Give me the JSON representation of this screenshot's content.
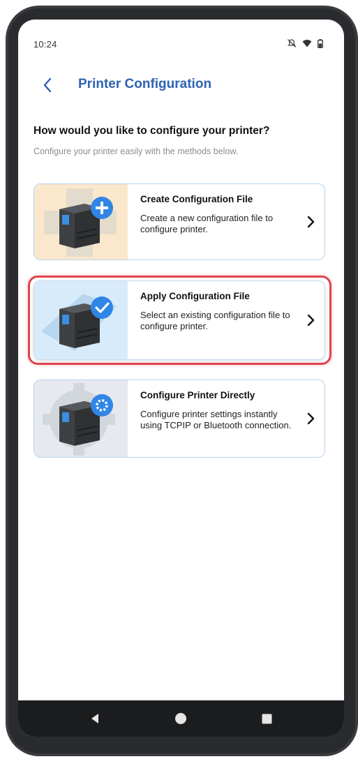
{
  "status_bar": {
    "time": "10:24",
    "icons": [
      "notifications-off-icon",
      "wifi-icon",
      "battery-icon"
    ]
  },
  "app_bar": {
    "back_icon": "chevron-left-icon",
    "title": "Printer Configuration"
  },
  "prompt": {
    "heading": "How would you like to configure your printer?",
    "subheading": "Configure your printer easily with the methods below."
  },
  "options": [
    {
      "title": "Create Configuration File",
      "description": "Create a new configuration file to configure printer.",
      "icon": "printer-add-icon",
      "selected": false
    },
    {
      "title": "Apply Configuration File",
      "description": "Select an existing configuration file to configure printer.",
      "icon": "printer-check-icon",
      "selected": true
    },
    {
      "title": "Configure Printer Directly",
      "description": "Configure printer settings instantly using TCPIP or Bluetooth connection.",
      "icon": "printer-settings-icon",
      "selected": false
    }
  ],
  "nav_bar": {
    "buttons": [
      "nav-back-icon",
      "nav-home-icon",
      "nav-recents-icon"
    ]
  },
  "colors": {
    "accent": "#2d63b4",
    "highlight": "#e0454e",
    "card_border": "#b7d3ee",
    "badge_blue": "#2f86e6"
  }
}
